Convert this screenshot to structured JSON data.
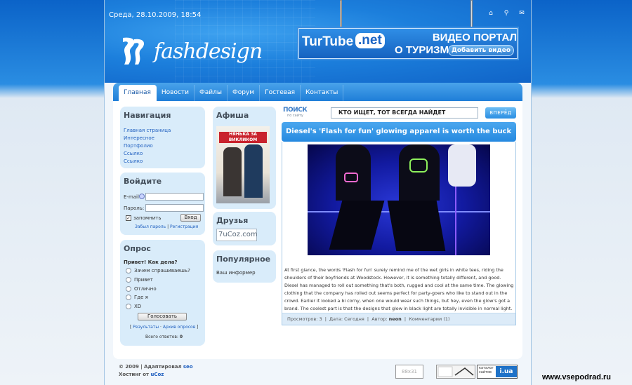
{
  "header": {
    "date": "Среда, 28.10.2009, 18:54",
    "icons": [
      "home-icon",
      "sitemap-icon",
      "mail-icon"
    ],
    "logo_text": "fashdesign"
  },
  "banner": {
    "brand_left": "TurTube",
    "brand_right": ".net",
    "line1": "ВИДЕО ПОРТАЛ",
    "line2": "О ТУРИЗМЕ",
    "button": "Добавить видео"
  },
  "nav": {
    "tabs": [
      "Главная",
      "Новости",
      "Файлы",
      "Форум",
      "Гостевая",
      "Контакты"
    ],
    "active": 0
  },
  "navigation_box": {
    "title": "Навигация",
    "links": [
      "Главная страница",
      "Интересное",
      "Портфолио",
      "Ссылко",
      "Ссылко"
    ]
  },
  "login_box": {
    "title": "Войдите",
    "email_label": "E-mail:",
    "password_label": "Пароль:",
    "remember_label": "запомнить",
    "login_button": "Вход",
    "forgot_link": "Забыл пароль",
    "separator": "|",
    "register_link": "Регистрация"
  },
  "poll_box": {
    "title": "Опрос",
    "question": "Привет! Как дела?",
    "options": [
      "Зачем спрашиваешь?",
      "Привет",
      "Отлично",
      "Где я",
      "XD"
    ],
    "vote_button": "Голосовать",
    "bracket_open": "[",
    "results_link": "Результаты",
    "dot": "·",
    "archive_link": "Архив опросов",
    "bracket_close": "]",
    "total_label": "Всего ответов:",
    "total_value": "0"
  },
  "afisha_box": {
    "title": "Афиша",
    "poster_text": "НЯНЬКА ЗА ВИКЛИКОМ"
  },
  "friends_box": {
    "title": "Друзья",
    "logo_text": "7uCoz.com"
  },
  "popular_box": {
    "title": "Популярное",
    "text": "Ваш информер"
  },
  "search": {
    "logo": "ПОИСК",
    "sub": "по сайту",
    "placeholder": "КТО ИЩЕТ, ТОТ ВСЕГДА НАЙДЕТ",
    "button": "ВПЕРЁД"
  },
  "article": {
    "title": "Diesel's 'Flash for fun' glowing apparel is worth the buck",
    "text": "At first glance, the words 'Flash for fun' surely remind me of the wet girls in white tees, riding the shoulders of their boyfriends at Woodstock. However, it is something totally different, and good. Diesel has managed to roll out something that's both, rugged and cool at the same time. The glowing clothing that the company has rolled out seems perfect for party-goers who like to stand out in the crowd. Earlier it looked a bi corny, when one would wear such things, but hey, even the glow's got a brand. The coolest part is that the designs that glow in black light are totally invisible in normal light.",
    "views_label": "Просмотров:",
    "views_value": "3",
    "date_label": "Дата:",
    "date_value": "Сегодня",
    "author_label": "Автор:",
    "author_value": "neon",
    "comments": "Комментарии (1)"
  },
  "footer": {
    "copyright": "© 2009",
    "separator": "|",
    "adapted": "Адаптировал",
    "adapter": "seo",
    "hosting": "Хостинг от",
    "host": "uCoz",
    "counter1": "88x31",
    "catalog": "каталог сайтов",
    "catalog_domain": "i.ua"
  },
  "watermark": "www.vsepodrad.ru"
}
